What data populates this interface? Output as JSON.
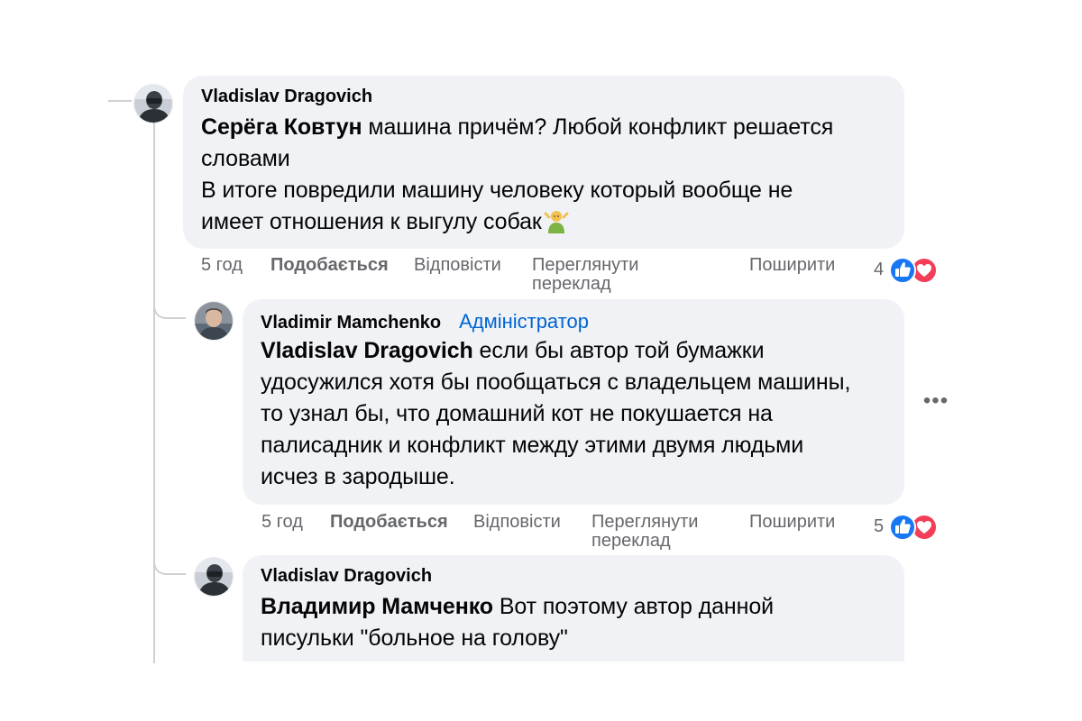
{
  "comments": [
    {
      "author": "Vladislav Dragovich",
      "role": "",
      "mention": "Серёга Ковтун",
      "lines": [
        " машина причём? Любой конфликт решается",
        "словами",
        "В итоге повредили машину человеку который вообще не",
        "имеет отношения к выгулу собак"
      ],
      "emoji": "man-shrugging-icon",
      "time": "5 год",
      "like_label": "Подобається",
      "reply_label": "Відповісти",
      "translate_label": "Переглянути переклад",
      "share_label": "Поширити",
      "reaction_count": "4"
    },
    {
      "author": "Vladimir Mamchenko",
      "role": "Адміністратор",
      "mention": "Vladislav Dragovich",
      "lines": [
        " если бы автор той бумажки",
        "удосужился хотя бы пообщаться с владельцем машины,",
        "то узнал бы, что домашний кот не покушается на",
        "палисадник и конфликт между этими двумя людьми",
        "исчез в зародыше."
      ],
      "time": "5 год",
      "like_label": "Подобається",
      "reply_label": "Відповісти",
      "translate_label": "Переглянути переклад",
      "share_label": "Поширити",
      "reaction_count": "5",
      "more_label": "•••"
    },
    {
      "author": "Vladislav Dragovich",
      "role": "",
      "mention": "Владимир Мамченко",
      "lines": [
        " Вот поэтому автор данной",
        "писульки \"больное на голову\""
      ]
    }
  ],
  "colors": {
    "bubble": "#f0f2f5",
    "thread_line": "#ced0d4",
    "admin_badge": "#0064d1",
    "like_blue": "#1877f2",
    "love_red": "#f33e58",
    "secondary_text": "#65676b"
  },
  "icons": {
    "avatar_1": "masked-man-avatar",
    "avatar_2": "man-avatar",
    "avatar_3": "masked-man-avatar",
    "reaction_like": "like-reaction-icon",
    "reaction_love": "love-reaction-icon"
  }
}
